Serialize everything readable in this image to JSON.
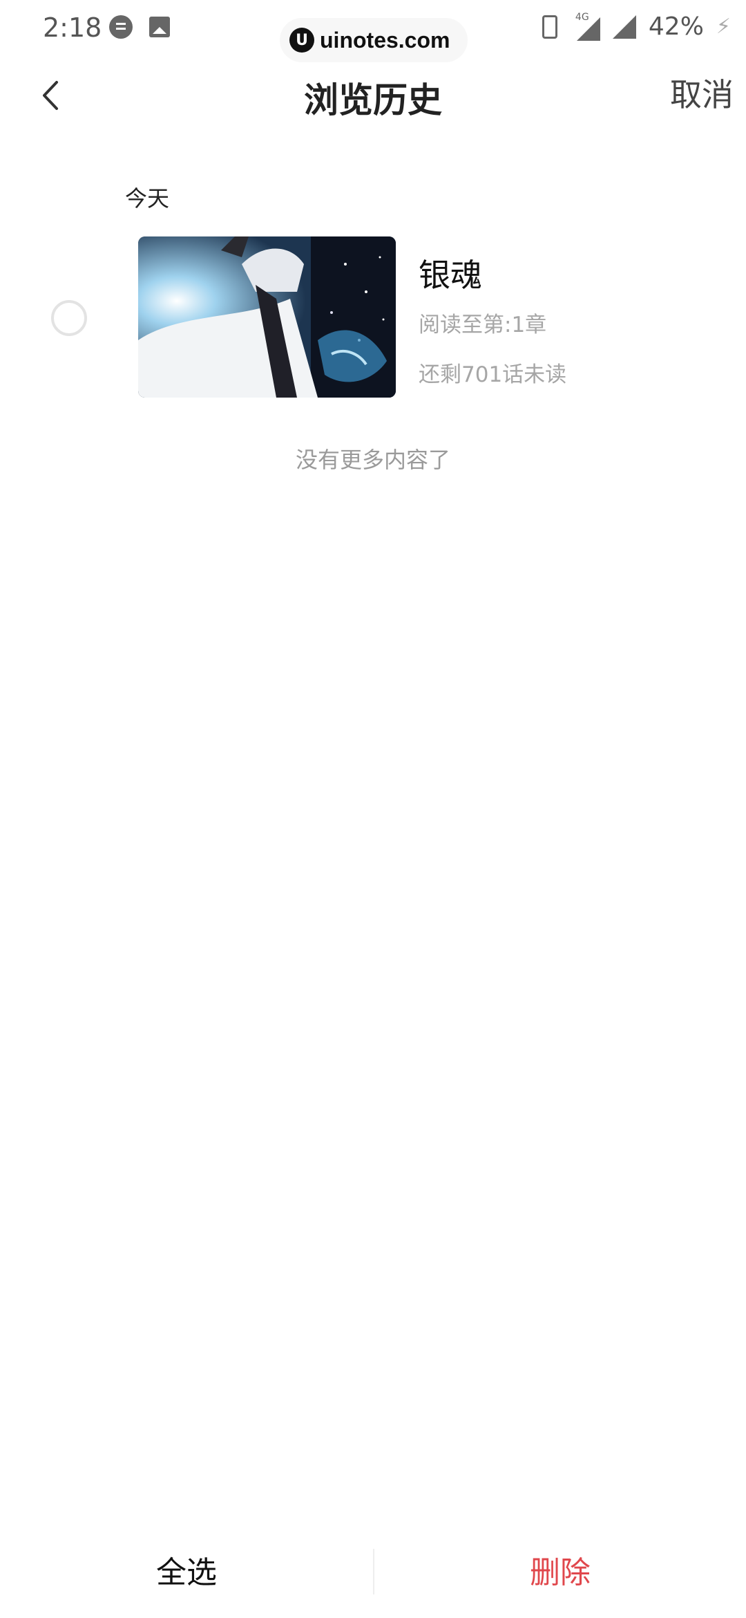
{
  "status_bar": {
    "time": "2:18",
    "network": "4G",
    "battery": "42%",
    "icons": [
      "chat-icon",
      "gallery-icon",
      "vibrate-icon",
      "signal-icon",
      "charging-icon"
    ]
  },
  "watermark": {
    "logo": "U",
    "text": "uinotes.com"
  },
  "header": {
    "back_icon": "chevron-left-icon",
    "title": "浏览历史",
    "cancel_label": "取消"
  },
  "history": {
    "section_label": "今天",
    "items": [
      {
        "title": "银魂",
        "progress": "阅读至第:1章",
        "remaining": "还剩701话未读",
        "selected": false
      }
    ],
    "end_note": "没有更多内容了"
  },
  "bottom_bar": {
    "select_all_label": "全选",
    "delete_label": "删除"
  },
  "colors": {
    "delete": "#e0474c",
    "muted_text": "#a6a6a6",
    "title_text": "#222222"
  }
}
